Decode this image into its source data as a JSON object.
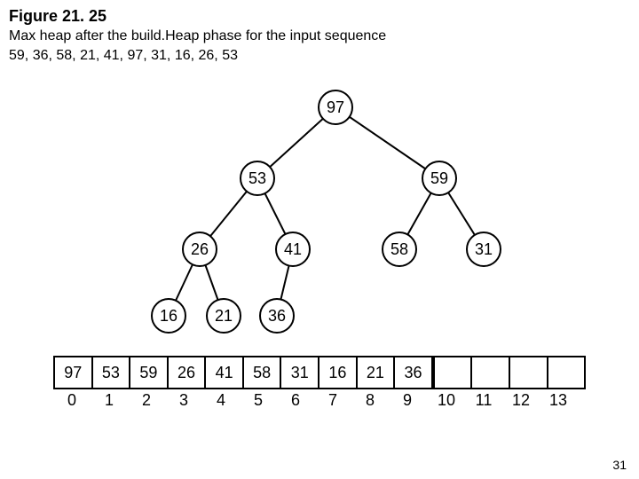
{
  "figure": {
    "label": "Figure 21. 25",
    "caption_line1": "Max heap after the build.Heap phase for the input sequence",
    "caption_line2": "59, 36, 58, 21, 41, 97, 31, 16, 26, 53"
  },
  "chart_data": {
    "type": "tree",
    "tree": {
      "value": 97,
      "children": [
        {
          "value": 53,
          "children": [
            {
              "value": 26,
              "children": [
                {
                  "value": 16
                },
                {
                  "value": 21
                }
              ]
            },
            {
              "value": 41,
              "children": [
                {
                  "value": 36
                }
              ]
            }
          ]
        },
        {
          "value": 59,
          "children": [
            {
              "value": 58
            },
            {
              "value": 31
            }
          ]
        }
      ]
    },
    "array": {
      "values": [
        "97",
        "53",
        "59",
        "26",
        "41",
        "58",
        "31",
        "16",
        "21",
        "36",
        "",
        "",
        "",
        ""
      ],
      "indices": [
        "0",
        "1",
        "2",
        "3",
        "4",
        "5",
        "6",
        "7",
        "8",
        "9",
        "10",
        "11",
        "12",
        "13"
      ],
      "separator_after_index": 9
    }
  },
  "nodes": {
    "n0": "97",
    "n1": "53",
    "n2": "59",
    "n3": "26",
    "n4": "41",
    "n5": "58",
    "n6": "31",
    "n7": "16",
    "n8": "21",
    "n9": "36"
  },
  "page_number": "31"
}
